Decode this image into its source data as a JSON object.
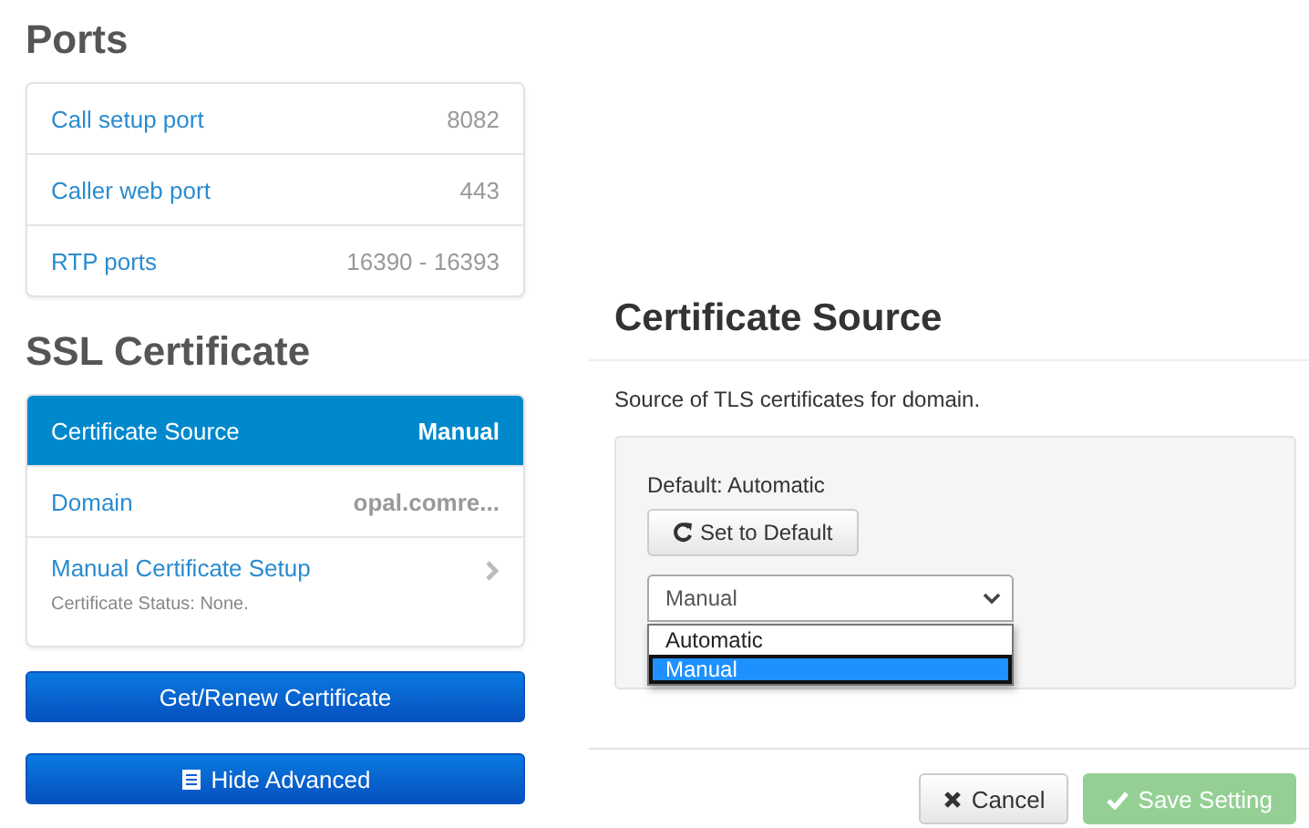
{
  "ports": {
    "title": "Ports",
    "items": [
      {
        "label": "Call setup port",
        "value": "8082"
      },
      {
        "label": "Caller web port",
        "value": "443"
      },
      {
        "label": "RTP ports",
        "value": "16390 - 16393"
      }
    ]
  },
  "ssl": {
    "title": "SSL Certificate",
    "items": [
      {
        "kind": "value",
        "label": "Certificate Source",
        "value": "Manual",
        "selected": true
      },
      {
        "kind": "value",
        "label": "Domain",
        "value": "opal.comre...",
        "selected": false
      },
      {
        "kind": "link",
        "label": "Manual Certificate Setup",
        "note": "Certificate Status: None.",
        "selected": false
      }
    ]
  },
  "actions": [
    {
      "label": "Get/Renew Certificate",
      "kind": "plain"
    },
    {
      "label": "Hide Advanced",
      "kind": "toggle"
    }
  ],
  "dialog": {
    "title": "Certificate Source",
    "description": "Source of TLS certificates for domain.",
    "default_text": "Default: Automatic",
    "reset_button": "Set to Default",
    "select": {
      "value": "Manual",
      "expanded": true,
      "options": [
        {
          "label": "Automatic",
          "selected": false
        },
        {
          "label": "Manual",
          "selected": true
        }
      ]
    },
    "buttons": [
      {
        "kind": "cancel",
        "label": "Cancel",
        "disabled": false
      },
      {
        "kind": "save",
        "label": "Save Setting",
        "disabled": true
      }
    ]
  }
}
